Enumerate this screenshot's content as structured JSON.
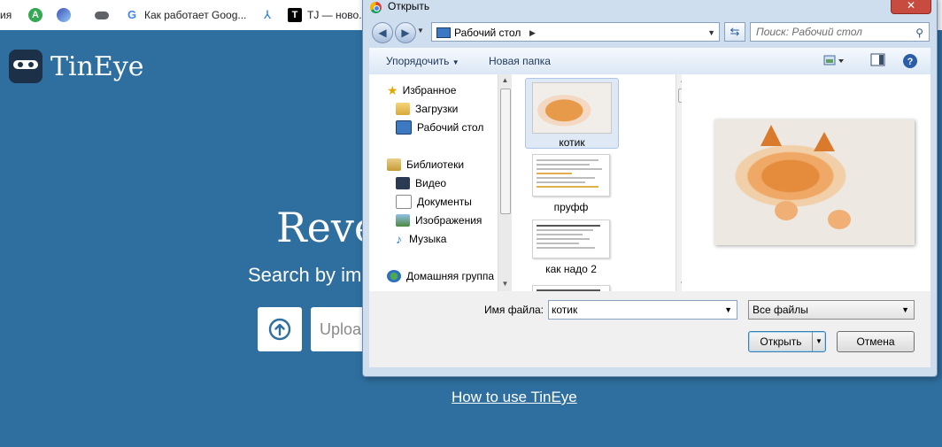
{
  "bookmarks": {
    "items": [
      {
        "label": "ия",
        "icon": "",
        "color": ""
      },
      {
        "label": "",
        "icon": "green-a-icon",
        "color": "#34a853"
      },
      {
        "label": "",
        "icon": "blue-circle-icon",
        "color": "#3f51b5"
      },
      {
        "label": "",
        "icon": "toggle-icon",
        "color": "#5f6368"
      },
      {
        "label": "Как работает Goog...",
        "icon": "google-icon",
        "color": "#4285f4"
      },
      {
        "label": "",
        "icon": "pdf-icon",
        "color": "#1a73e8"
      },
      {
        "label": "TJ — ново...",
        "icon": "tj-icon",
        "color": "#000000"
      }
    ]
  },
  "tineye": {
    "logo_text": "TinEye",
    "hero_title": "Reve",
    "hero_sub": "Search by im",
    "upload_placeholder": "Uploa",
    "howto_link": "How to use TinEye",
    "bg_color": "#2f6f9f"
  },
  "dialog": {
    "title": "Открыть",
    "close_label": "✕",
    "address": "Рабочий стол",
    "search_placeholder": "Поиск: Рабочий стол",
    "toolbar": {
      "organize": "Упорядочить",
      "new_folder": "Новая папка"
    },
    "nav": {
      "favorites_header": "Избранное",
      "favorites": [
        "Загрузки",
        "Рабочий стол"
      ],
      "libraries_header": "Библиотеки",
      "libraries": [
        "Видео",
        "Документы",
        "Изображения",
        "Музыка"
      ],
      "homegroup": "Домашняя группа"
    },
    "files": [
      {
        "name": "котик",
        "selected": true
      },
      {
        "name": "пруфф",
        "selected": false
      },
      {
        "name": "как надо 2",
        "selected": false
      }
    ],
    "filename_label": "Имя файла:",
    "filename_value": "котик",
    "filetype": "Все файлы",
    "open_button": "Открыть",
    "cancel_button": "Отмена"
  }
}
